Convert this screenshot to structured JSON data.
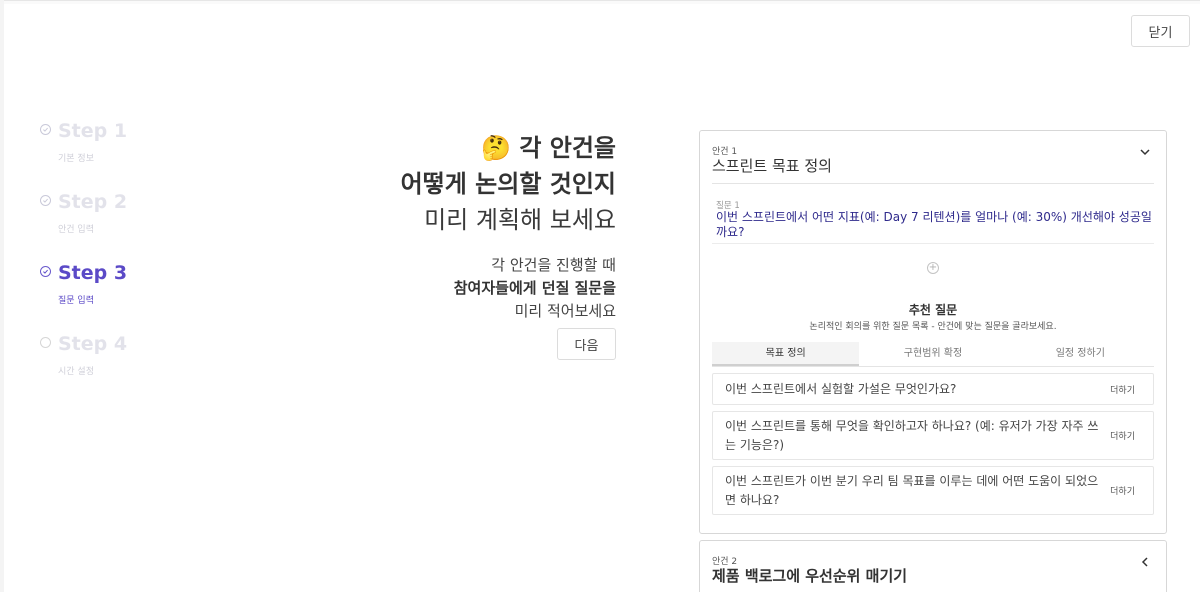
{
  "header": {
    "close_label": "닫기"
  },
  "steps": [
    {
      "title": "Step 1",
      "sub": "기본 정보",
      "state": "done"
    },
    {
      "title": "Step 2",
      "sub": "안건 입력",
      "state": "done"
    },
    {
      "title": "Step 3",
      "sub": "질문 입력",
      "state": "active"
    },
    {
      "title": "Step 4",
      "sub": "시간 설정",
      "state": "pending"
    }
  ],
  "intro": {
    "emoji": "🤔",
    "line1": "각 안건을",
    "line2": "어떻게 논의할 것인지",
    "line3": "미리 계획해 보세요",
    "desc1": "각 안건을 진행할 때",
    "desc2": "참여자들에게 던질 질문을",
    "desc3": "미리 적어보세요",
    "next_label": "다음"
  },
  "agenda1": {
    "number": "안건 1",
    "title": "스프린트 목표 정의",
    "question_label": "질문 1",
    "question_text": "이번 스프린트에서 어떤 지표(예: Day 7 리텐션)를 얼마나 (예: 30%) 개선해야 성공일까요?",
    "rec_title": "추천 질문",
    "rec_sub": "논리적인 회의를 위한 질문 목록 - 안건에 맞는 질문을 골라보세요.",
    "tabs": [
      "목표 정의",
      "구현범위 확정",
      "일정 정하기"
    ],
    "recommendations": [
      {
        "text": "이번 스프린트에서 실험할 가설은 무엇인가요?",
        "add": "더하기"
      },
      {
        "text": "이번 스프린트를 통해 무엇을 확인하고자 하나요? (예: 유저가 가장 자주 쓰는 기능은?)",
        "add": "더하기"
      },
      {
        "text": "이번 스프린트가 이번 분기 우리 팀 목표를 이루는 데에 어떤 도움이 되었으면 하나요?",
        "add": "더하기"
      }
    ]
  },
  "agenda2": {
    "number": "안건 2",
    "title": "제품 백로그에 우선순위 매기기"
  },
  "icons": {
    "step_done": "check-circle-icon",
    "step_pending": "empty-circle-icon",
    "expand": "chevron-down-icon",
    "collapse": "chevron-left-icon",
    "add_question": "plus-circle-icon"
  },
  "colors": {
    "accent": "#5b4ac7",
    "question_text": "#2f2a8c",
    "inactive_step": "#e2e2ea"
  }
}
